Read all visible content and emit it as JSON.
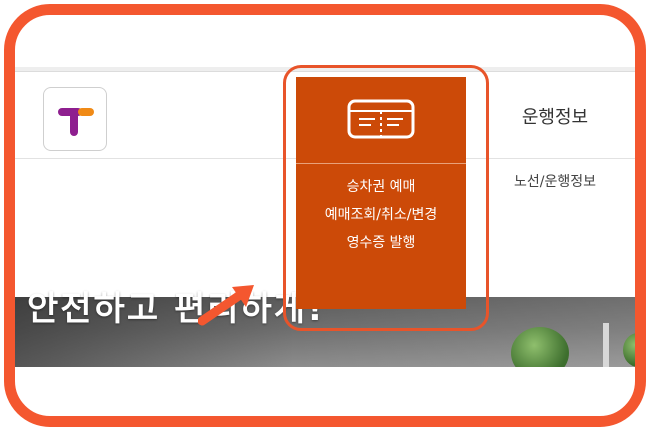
{
  "header": {
    "logo_letter": "T",
    "menu": {
      "title": "운행정보",
      "sub_items": [
        "노선/운행정보"
      ]
    }
  },
  "dropdown": {
    "icon": "ticket-icon",
    "items": [
      "승차권 예매",
      "예매조회/취소/변경",
      "영수증 발행"
    ]
  },
  "banner": {
    "text": "안전하고 편리하게!"
  },
  "colors": {
    "frame_border": "#f4572f",
    "dropdown_bg": "#cc4a08",
    "highlight_border": "#e8542a",
    "logo_purple": "#8e1f8f",
    "logo_orange": "#f08a16"
  }
}
